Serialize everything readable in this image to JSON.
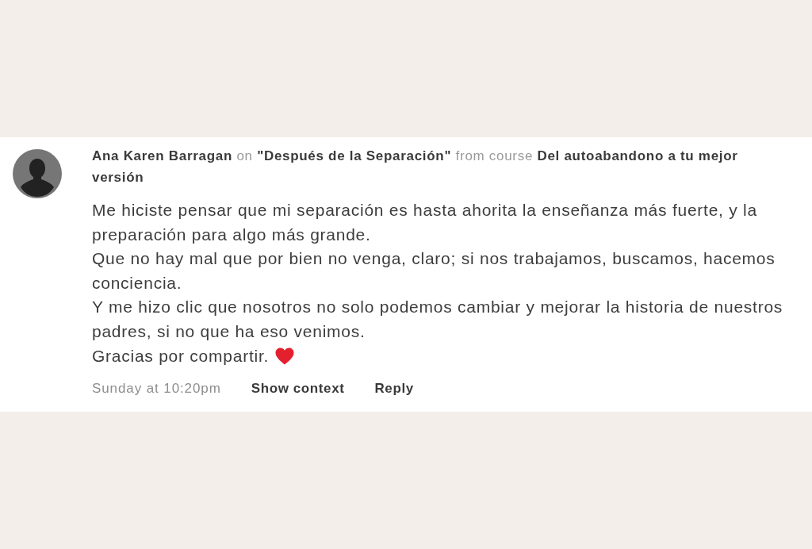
{
  "comment": {
    "header": "**Ana Karen Barragan** on **\"Después de la Separación\"** from course **Del autoabandono a tu mejor versión**",
    "body": [
      {
        "text": "Me hiciste pensar que mi separación es hasta ahorita la enseñanza más fuerte, y la preparación para algo más grande.",
        "emoji": false
      },
      {
        "text": "Que no hay mal que por bien no venga, claro; si nos trabajamos, buscamos, hacemos conciencia.",
        "emoji": false
      },
      {
        "text": "Y me hizo clic que nosotros no solo podemos cambiar y mejorar la historia de nuestros padres, si no que ha eso venimos.",
        "emoji": false
      },
      {
        "text": "Gracias por compartir.",
        "emoji": true
      }
    ],
    "timestamp": "Sunday at 10:20pm",
    "actions": [
      "Show context",
      "Reply"
    ]
  }
}
